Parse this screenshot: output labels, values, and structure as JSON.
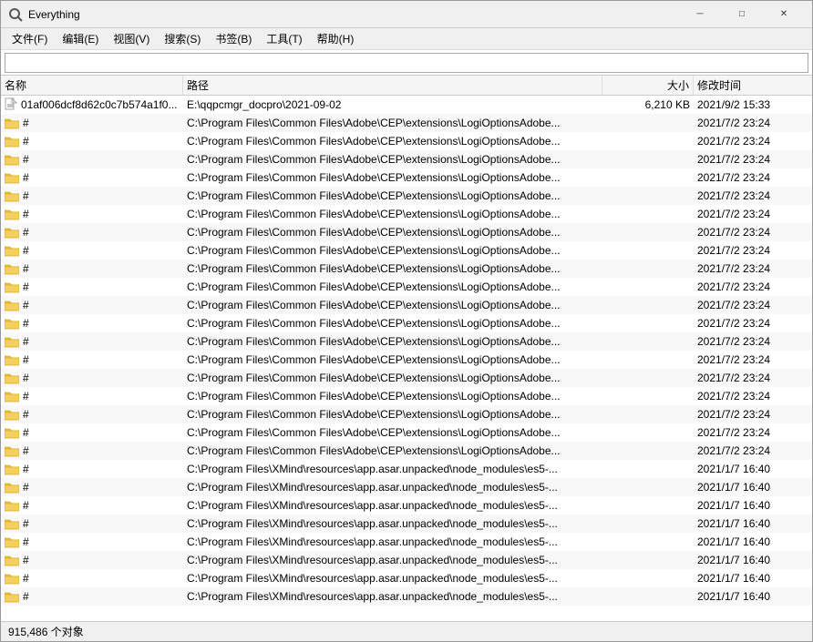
{
  "window": {
    "title": "Everything",
    "icon": "🔍"
  },
  "titlebar": {
    "minimize": "─",
    "maximize": "□",
    "close": "✕"
  },
  "menu": {
    "items": [
      {
        "label": "文件(F)"
      },
      {
        "label": "编辑(E)"
      },
      {
        "label": "视图(V)"
      },
      {
        "label": "搜索(S)"
      },
      {
        "label": "书签(B)"
      },
      {
        "label": "工具(T)"
      },
      {
        "label": "帮助(H)"
      }
    ]
  },
  "search": {
    "value": "",
    "placeholder": ""
  },
  "columns": {
    "name": "名称",
    "path": "路径",
    "size": "大小",
    "date": "修改时间"
  },
  "rows": [
    {
      "name": "01af006dcf8d62c0c7b574a1f0...",
      "path": "E:\\qqpcmgr_docpro\\2021-09-02",
      "size": "6,210 KB",
      "date": "2021/9/2 15:33",
      "icon": "doc"
    },
    {
      "name": "#",
      "path": "C:\\Program Files\\Common Files\\Adobe\\CEP\\extensions\\LogiOptionsAdobe...",
      "size": "",
      "date": "2021/7/2 23:24",
      "icon": "folder"
    },
    {
      "name": "#",
      "path": "C:\\Program Files\\Common Files\\Adobe\\CEP\\extensions\\LogiOptionsAdobe...",
      "size": "",
      "date": "2021/7/2 23:24",
      "icon": "folder"
    },
    {
      "name": "#",
      "path": "C:\\Program Files\\Common Files\\Adobe\\CEP\\extensions\\LogiOptionsAdobe...",
      "size": "",
      "date": "2021/7/2 23:24",
      "icon": "folder"
    },
    {
      "name": "#",
      "path": "C:\\Program Files\\Common Files\\Adobe\\CEP\\extensions\\LogiOptionsAdobe...",
      "size": "",
      "date": "2021/7/2 23:24",
      "icon": "folder"
    },
    {
      "name": "#",
      "path": "C:\\Program Files\\Common Files\\Adobe\\CEP\\extensions\\LogiOptionsAdobe...",
      "size": "",
      "date": "2021/7/2 23:24",
      "icon": "folder"
    },
    {
      "name": "#",
      "path": "C:\\Program Files\\Common Files\\Adobe\\CEP\\extensions\\LogiOptionsAdobe...",
      "size": "",
      "date": "2021/7/2 23:24",
      "icon": "folder"
    },
    {
      "name": "#",
      "path": "C:\\Program Files\\Common Files\\Adobe\\CEP\\extensions\\LogiOptionsAdobe...",
      "size": "",
      "date": "2021/7/2 23:24",
      "icon": "folder"
    },
    {
      "name": "#",
      "path": "C:\\Program Files\\Common Files\\Adobe\\CEP\\extensions\\LogiOptionsAdobe...",
      "size": "",
      "date": "2021/7/2 23:24",
      "icon": "folder"
    },
    {
      "name": "#",
      "path": "C:\\Program Files\\Common Files\\Adobe\\CEP\\extensions\\LogiOptionsAdobe...",
      "size": "",
      "date": "2021/7/2 23:24",
      "icon": "folder"
    },
    {
      "name": "#",
      "path": "C:\\Program Files\\Common Files\\Adobe\\CEP\\extensions\\LogiOptionsAdobe...",
      "size": "",
      "date": "2021/7/2 23:24",
      "icon": "folder"
    },
    {
      "name": "#",
      "path": "C:\\Program Files\\Common Files\\Adobe\\CEP\\extensions\\LogiOptionsAdobe...",
      "size": "",
      "date": "2021/7/2 23:24",
      "icon": "folder"
    },
    {
      "name": "#",
      "path": "C:\\Program Files\\Common Files\\Adobe\\CEP\\extensions\\LogiOptionsAdobe...",
      "size": "",
      "date": "2021/7/2 23:24",
      "icon": "folder"
    },
    {
      "name": "#",
      "path": "C:\\Program Files\\Common Files\\Adobe\\CEP\\extensions\\LogiOptionsAdobe...",
      "size": "",
      "date": "2021/7/2 23:24",
      "icon": "folder"
    },
    {
      "name": "#",
      "path": "C:\\Program Files\\Common Files\\Adobe\\CEP\\extensions\\LogiOptionsAdobe...",
      "size": "",
      "date": "2021/7/2 23:24",
      "icon": "folder"
    },
    {
      "name": "#",
      "path": "C:\\Program Files\\Common Files\\Adobe\\CEP\\extensions\\LogiOptionsAdobe...",
      "size": "",
      "date": "2021/7/2 23:24",
      "icon": "folder"
    },
    {
      "name": "#",
      "path": "C:\\Program Files\\Common Files\\Adobe\\CEP\\extensions\\LogiOptionsAdobe...",
      "size": "",
      "date": "2021/7/2 23:24",
      "icon": "folder"
    },
    {
      "name": "#",
      "path": "C:\\Program Files\\Common Files\\Adobe\\CEP\\extensions\\LogiOptionsAdobe...",
      "size": "",
      "date": "2021/7/2 23:24",
      "icon": "folder"
    },
    {
      "name": "#",
      "path": "C:\\Program Files\\Common Files\\Adobe\\CEP\\extensions\\LogiOptionsAdobe...",
      "size": "",
      "date": "2021/7/2 23:24",
      "icon": "folder"
    },
    {
      "name": "#",
      "path": "C:\\Program Files\\Common Files\\Adobe\\CEP\\extensions\\LogiOptionsAdobe...",
      "size": "",
      "date": "2021/7/2 23:24",
      "icon": "folder"
    },
    {
      "name": "#",
      "path": "C:\\Program Files\\XMind\\resources\\app.asar.unpacked\\node_modules\\es5-...",
      "size": "",
      "date": "2021/1/7 16:40",
      "icon": "folder"
    },
    {
      "name": "#",
      "path": "C:\\Program Files\\XMind\\resources\\app.asar.unpacked\\node_modules\\es5-...",
      "size": "",
      "date": "2021/1/7 16:40",
      "icon": "folder"
    },
    {
      "name": "#",
      "path": "C:\\Program Files\\XMind\\resources\\app.asar.unpacked\\node_modules\\es5-...",
      "size": "",
      "date": "2021/1/7 16:40",
      "icon": "folder"
    },
    {
      "name": "#",
      "path": "C:\\Program Files\\XMind\\resources\\app.asar.unpacked\\node_modules\\es5-...",
      "size": "",
      "date": "2021/1/7 16:40",
      "icon": "folder"
    },
    {
      "name": "#",
      "path": "C:\\Program Files\\XMind\\resources\\app.asar.unpacked\\node_modules\\es5-...",
      "size": "",
      "date": "2021/1/7 16:40",
      "icon": "folder"
    },
    {
      "name": "#",
      "path": "C:\\Program Files\\XMind\\resources\\app.asar.unpacked\\node_modules\\es5-...",
      "size": "",
      "date": "2021/1/7 16:40",
      "icon": "folder"
    },
    {
      "name": "#",
      "path": "C:\\Program Files\\XMind\\resources\\app.asar.unpacked\\node_modules\\es5-...",
      "size": "",
      "date": "2021/1/7 16:40",
      "icon": "folder"
    },
    {
      "name": "#",
      "path": "C:\\Program Files\\XMind\\resources\\app.asar.unpacked\\node_modules\\es5-...",
      "size": "",
      "date": "2021/1/7 16:40",
      "icon": "folder"
    }
  ],
  "status": {
    "count": "915,486 个对象"
  }
}
